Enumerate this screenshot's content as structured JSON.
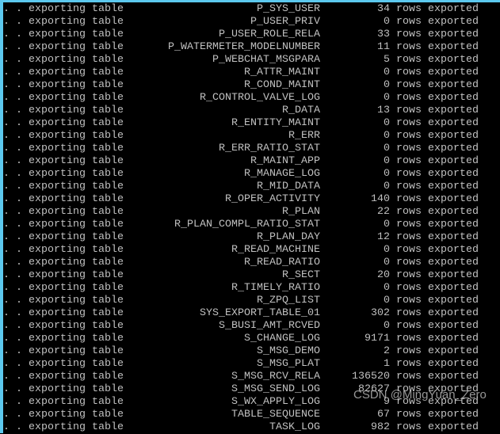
{
  "console": {
    "prefix": ". . exporting table",
    "suffix": "rows exported",
    "rows": [
      {
        "table": "P_SYS_USER",
        "count": "34"
      },
      {
        "table": "P_USER_PRIV",
        "count": "0"
      },
      {
        "table": "P_USER_ROLE_RELA",
        "count": "33"
      },
      {
        "table": "P_WATERMETER_MODELNUMBER",
        "count": "11"
      },
      {
        "table": "P_WEBCHAT_MSGPARA",
        "count": "5"
      },
      {
        "table": "R_ATTR_MAINT",
        "count": "0"
      },
      {
        "table": "R_COND_MAINT",
        "count": "0"
      },
      {
        "table": "R_CONTROL_VALVE_LOG",
        "count": "0"
      },
      {
        "table": "R_DATA",
        "count": "13"
      },
      {
        "table": "R_ENTITY_MAINT",
        "count": "0"
      },
      {
        "table": "R_ERR",
        "count": "0"
      },
      {
        "table": "R_ERR_RATIO_STAT",
        "count": "0"
      },
      {
        "table": "R_MAINT_APP",
        "count": "0"
      },
      {
        "table": "R_MANAGE_LOG",
        "count": "0"
      },
      {
        "table": "R_MID_DATA",
        "count": "0"
      },
      {
        "table": "R_OPER_ACTIVITY",
        "count": "140"
      },
      {
        "table": "R_PLAN",
        "count": "22"
      },
      {
        "table": "R_PLAN_COMPL_RATIO_STAT",
        "count": "0"
      },
      {
        "table": "R_PLAN_DAY",
        "count": "12"
      },
      {
        "table": "R_READ_MACHINE",
        "count": "0"
      },
      {
        "table": "R_READ_RATIO",
        "count": "0"
      },
      {
        "table": "R_SECT",
        "count": "20"
      },
      {
        "table": "R_TIMELY_RATIO",
        "count": "0"
      },
      {
        "table": "R_ZPQ_LIST",
        "count": "0"
      },
      {
        "table": "SYS_EXPORT_TABLE_01",
        "count": "302"
      },
      {
        "table": "S_BUSI_AMT_RCVED",
        "count": "0"
      },
      {
        "table": "S_CHANGE_LOG",
        "count": "9171"
      },
      {
        "table": "S_MSG_DEMO",
        "count": "2"
      },
      {
        "table": "S_MSG_PLAT",
        "count": "1"
      },
      {
        "table": "S_MSG_RCV_RELA",
        "count": "136520"
      },
      {
        "table": "S_MSG_SEND_LOG",
        "count": "82627"
      },
      {
        "table": "S_WX_APPLY_LOG",
        "count": "9"
      },
      {
        "table": "TABLE_SEQUENCE",
        "count": "67"
      },
      {
        "table": "TASK_LOG",
        "count": "982"
      }
    ]
  },
  "watermark": "CSDN @MingYuan_Zero",
  "colors": {
    "background": "#000000",
    "text": "#c0c0c0",
    "frame": "#5cc8ee"
  }
}
